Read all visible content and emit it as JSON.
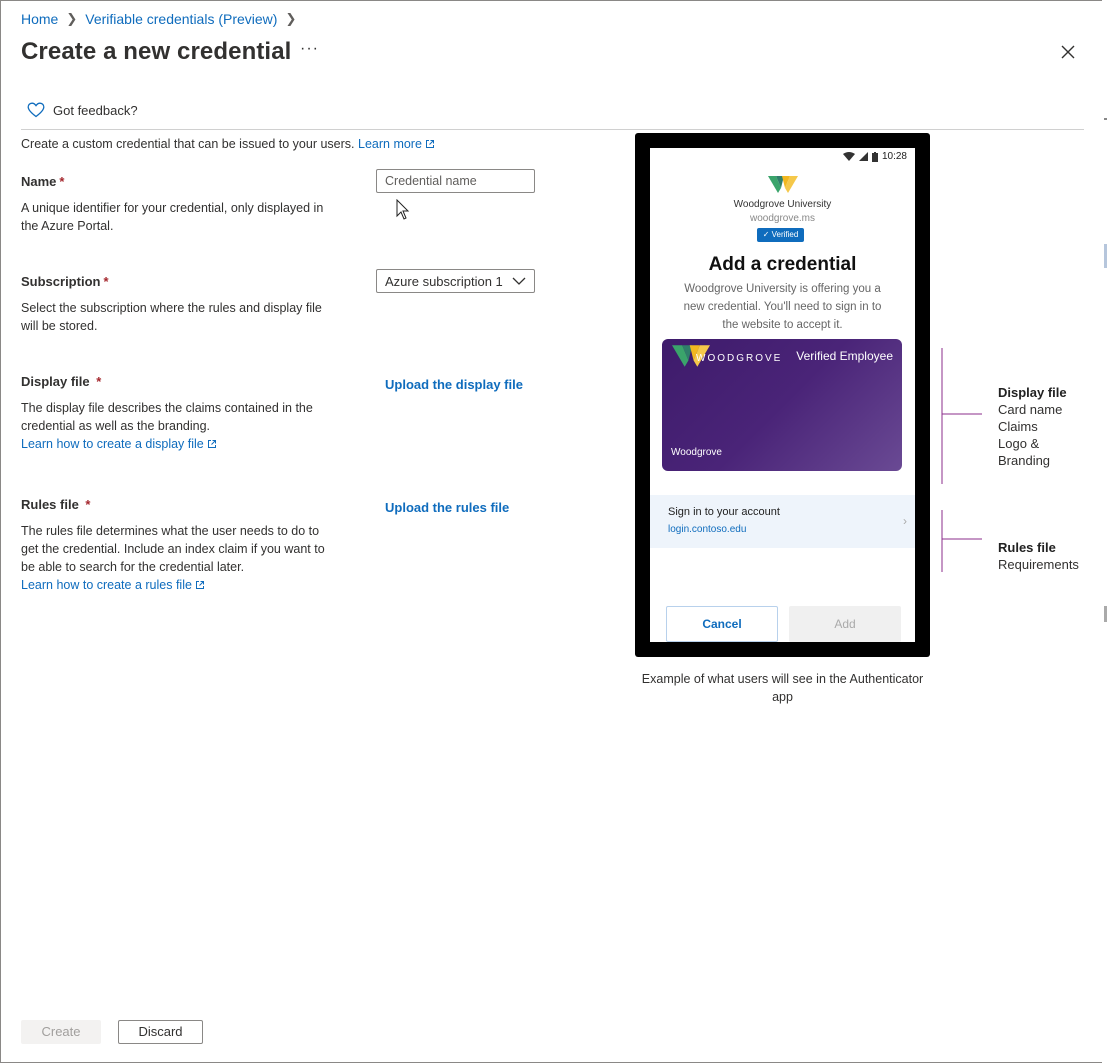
{
  "breadcrumb": {
    "home": "Home",
    "current": "Verifiable credentials (Preview)"
  },
  "header": {
    "title": "Create a new credential",
    "more": "···"
  },
  "feedback": {
    "label": "Got feedback?"
  },
  "intro": {
    "text": "Create a custom credential that can be issued to your users.",
    "learn_more": "Learn more"
  },
  "form": {
    "name": {
      "label": "Name",
      "required": "*",
      "placeholder": "Credential name",
      "description": "A unique identifier for your credential, only displayed in the Azure Portal."
    },
    "subscription": {
      "label": "Subscription",
      "required": "*",
      "value": "Azure subscription 1",
      "description": "Select the subscription where the rules and display file will be stored."
    },
    "display_file": {
      "label": "Display file",
      "required": "*",
      "description": "The display file describes the claims contained in the credential as well as the branding.",
      "learn_link": "Learn how to create a display file",
      "upload": "Upload the display file"
    },
    "rules_file": {
      "label": "Rules file",
      "required": "*",
      "description": "The rules file determines what the user needs to do to get the credential. Include an index claim if you want to be able to search for the credential later.",
      "learn_link": "Learn how to create a rules file",
      "upload": "Upload the rules file"
    }
  },
  "phone": {
    "time": "10:28",
    "org_name": "Woodgrove University",
    "org_domain": "woodgrove.ms",
    "verified_badge": "✓ Verified",
    "title": "Add a credential",
    "text": "Woodgrove University is offering you a new credential. You'll need to sign in to the website to accept it.",
    "card": {
      "brand": "WOODGROVE",
      "name": "Verified Employee",
      "issuer": "Woodgrove"
    },
    "signin": {
      "title": "Sign in to your account",
      "url": "login.contoso.edu"
    },
    "cancel": "Cancel",
    "add": "Add"
  },
  "caption": "Example of what users will see in the Authenticator app",
  "annotations": {
    "display": {
      "title": "Display file",
      "lines": [
        "Card name",
        "Claims",
        "Logo &",
        "Branding"
      ]
    },
    "rules": {
      "title": "Rules file",
      "lines": [
        "Requirements"
      ]
    }
  },
  "footer": {
    "create": "Create",
    "discard": "Discard"
  },
  "colors": {
    "link": "#0f6cbd",
    "required": "#a4262c",
    "card": "#4a2478",
    "bracket": "#8b2d8b"
  }
}
